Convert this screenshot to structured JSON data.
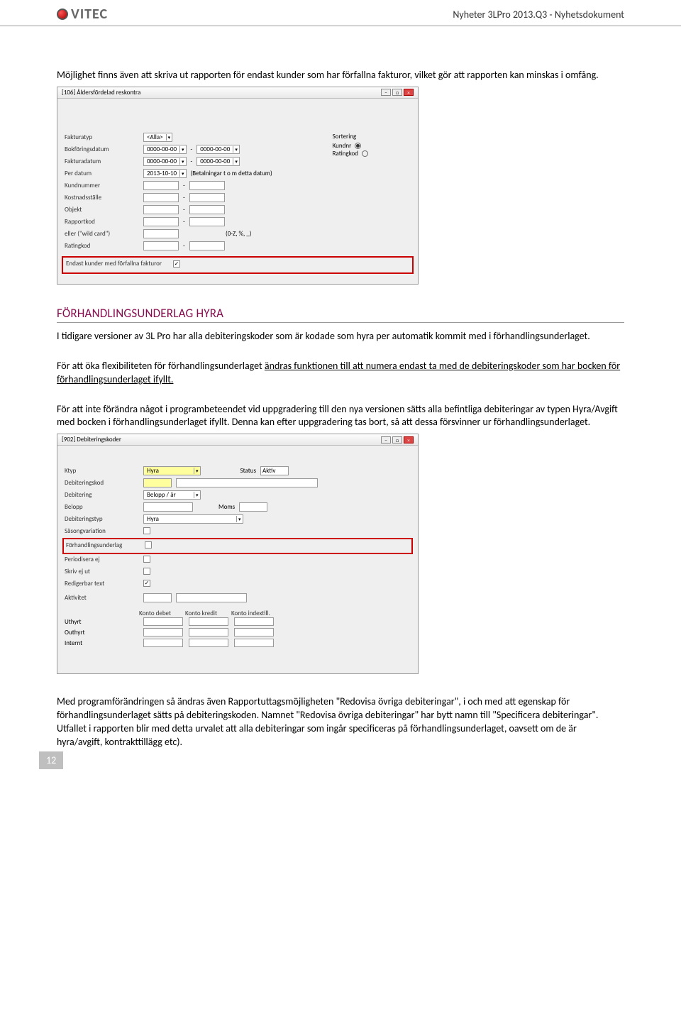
{
  "header": {
    "logo_text": "VITEC",
    "doc_title": "Nyheter 3LPro 2013.Q3 - Nyhetsdokument"
  },
  "intro_para": "Möjlighet finns även att skriva ut rapporten för endast kunder som har förfallna fakturor, vilket gör att rapporten kan minskas i omfång.",
  "win1": {
    "title": "[106] Åldersfördelad reskontra",
    "fields": {
      "fakturatyp": "Fakturatyp",
      "fakturatyp_val": "<Alla>",
      "bokforingsdatum": "Bokföringsdatum",
      "date_val": "0000-00-00",
      "fakturadatum": "Fakturadatum",
      "per_datum": "Per datum",
      "per_datum_val": "2013-10-10",
      "per_datum_note": "(Betalningar t o m detta datum)",
      "kundnummer": "Kundnummer",
      "kostnadsstalle": "Kostnadsställe",
      "objekt": "Objekt",
      "rapportkod": "Rapportkod",
      "wildcard": "eller (\"wild card\")",
      "wildcard_note": "(0-Z, %, _)",
      "ratingkod": "Ratingkod",
      "checkbox_label": "Endast kunder med förfallna fakturor"
    },
    "sorting": {
      "title": "Sortering",
      "opt1": "Kundnr",
      "opt2": "Ratingkod"
    }
  },
  "section": {
    "heading": "FÖRHANDLINGSUNDERLAG HYRA",
    "p1": "I tidigare versioner av 3L Pro har alla debiteringskoder som är kodade som hyra per automatik kommit med i förhandlingsunderlaget.",
    "p2a": "För att öka flexibiliteten för förhandlingsunderlaget ",
    "p2b": "ändras funktionen till att numera endast ta med de debiteringskoder som har bocken för förhandlingsunderlaget ifyllt.",
    "p3": "För att inte förändra något i programbeteendet vid uppgradering till den nya versionen sätts alla befintliga debiteringar av typen Hyra/Avgift med bocken i förhandlingsunderlaget ifyllt. Denna kan efter uppgradering tas bort, så att dessa försvinner ur förhandlingsunderlaget."
  },
  "win2": {
    "title": "[902] Debiteringskoder",
    "fields": {
      "ktyp": "Ktyp",
      "ktyp_val": "Hyra",
      "status": "Status",
      "status_val": "Aktiv",
      "debiteringskod": "Debiteringskod",
      "debitering": "Debitering",
      "debitering_val": "Belopp / år",
      "belopp": "Belopp",
      "moms": "Moms",
      "debiteringstyp": "Debiteringstyp",
      "debiteringstyp_val": "Hyra",
      "sasongvariation": "Säsongvariation",
      "forhandling": "Förhandlingsunderlag",
      "periodisera": "Periodisera ej",
      "skriv": "Skriv ej ut",
      "redigerbar": "Redigerbar text",
      "aktivitet": "Aktivitet"
    },
    "account_headers": {
      "h1": "Konto debet",
      "h2": "Konto kredit",
      "h3": "Konto indextill."
    },
    "account_rows": {
      "r1": "Uthyrt",
      "r2": "Outhyrt",
      "r3": "Internt"
    }
  },
  "closing_para": "Med programförändringen så ändras även Rapportuttagsmöjligheten \"Redovisa övriga debiteringar\", i och med att egenskap för förhandlingsunderlaget sätts på debiteringskoden. Namnet \"Redovisa övriga debiteringar\" har bytt namn till \"Specificera debiteringar\". Utfallet i rapporten blir med detta urvalet att alla debiteringar som ingår specificeras på förhandlingsunderlaget, oavsett om de är hyra/avgift, kontrakttillägg etc).",
  "page_number": "12"
}
